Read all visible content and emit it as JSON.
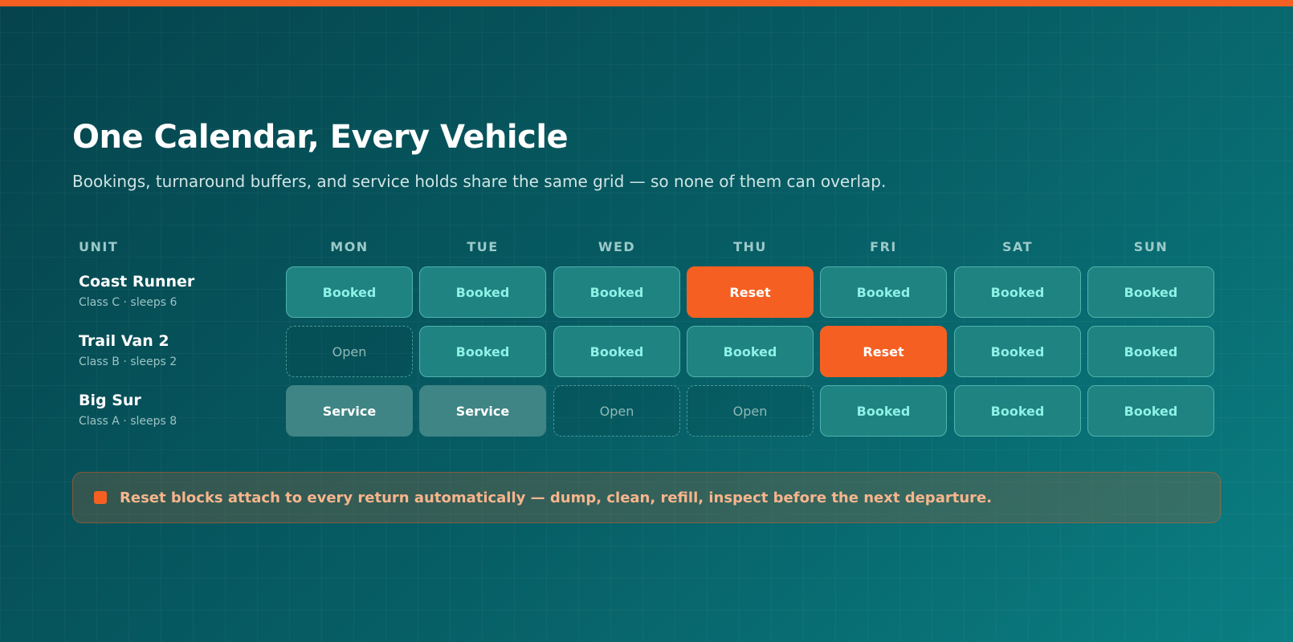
{
  "header": {
    "title": "One Calendar, Every Vehicle",
    "subtitle": "Bookings, turnaround buffers, and service holds share the same grid — so none of them can overlap."
  },
  "calendar": {
    "unit_header": "UNIT",
    "days": [
      "MON",
      "TUE",
      "WED",
      "THU",
      "FRI",
      "SAT",
      "SUN"
    ],
    "units": [
      {
        "name": "Coast Runner",
        "detail": "Class C · sleeps 6",
        "cells": [
          {
            "label": "Booked",
            "status": "booked"
          },
          {
            "label": "Booked",
            "status": "booked"
          },
          {
            "label": "Booked",
            "status": "booked"
          },
          {
            "label": "Reset",
            "status": "reset"
          },
          {
            "label": "Booked",
            "status": "booked"
          },
          {
            "label": "Booked",
            "status": "booked"
          },
          {
            "label": "Booked",
            "status": "booked"
          }
        ]
      },
      {
        "name": "Trail Van 2",
        "detail": "Class B · sleeps 2",
        "cells": [
          {
            "label": "Open",
            "status": "open"
          },
          {
            "label": "Booked",
            "status": "booked"
          },
          {
            "label": "Booked",
            "status": "booked"
          },
          {
            "label": "Booked",
            "status": "booked"
          },
          {
            "label": "Reset",
            "status": "reset"
          },
          {
            "label": "Booked",
            "status": "booked"
          },
          {
            "label": "Booked",
            "status": "booked"
          }
        ]
      },
      {
        "name": "Big Sur",
        "detail": "Class A · sleeps 8",
        "cells": [
          {
            "label": "Service",
            "status": "service"
          },
          {
            "label": "Service",
            "status": "service"
          },
          {
            "label": "Open",
            "status": "open"
          },
          {
            "label": "Open",
            "status": "open"
          },
          {
            "label": "Booked",
            "status": "booked"
          },
          {
            "label": "Booked",
            "status": "booked"
          },
          {
            "label": "Booked",
            "status": "booked"
          }
        ]
      }
    ]
  },
  "note": {
    "text": "Reset blocks attach to every return automatically — dump, clean, refill, inspect before the next departure."
  },
  "colors": {
    "accent": "#f56022",
    "booked": "#1f8381",
    "service": "#3f8585",
    "background": "#075f66"
  }
}
